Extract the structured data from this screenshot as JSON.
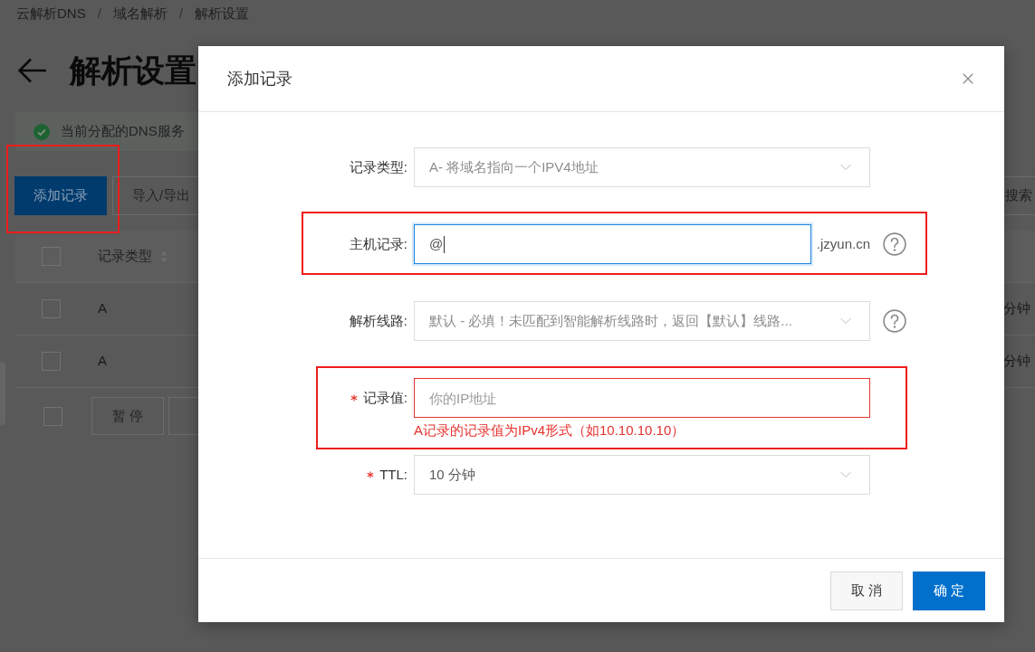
{
  "breadcrumb": {
    "items": [
      "云解析DNS",
      "域名解析",
      "解析设置"
    ],
    "separators": [
      "/",
      "/"
    ]
  },
  "page_title": "解析设置",
  "notice": {
    "text": "当前分配的DNS服务"
  },
  "toolbar": {
    "buttons": [
      {
        "label": "添加记录",
        "kind": "primary",
        "highlighted": true
      },
      {
        "label": "导入/导出",
        "kind": "default",
        "highlighted": false
      }
    ],
    "search_button": "搜索"
  },
  "table": {
    "header": {
      "checked": false,
      "columns": [
        "记录类型"
      ]
    },
    "rows": [
      {
        "checked": false,
        "record_type": "A",
        "column_3": "分钟"
      },
      {
        "checked": false,
        "record_type": "A",
        "column_3": "分钟"
      }
    ],
    "footer": {
      "checked": false,
      "buttons": [
        {
          "label": "暂 停",
          "disabled": true
        }
      ]
    }
  },
  "dialog": {
    "title": "添加记录",
    "fields": [
      {
        "kind": "select",
        "label": "记录类型:",
        "required": false,
        "value": "A- 将域名指向一个IPV4地址",
        "disabled": true,
        "help": false,
        "highlighted": false
      },
      {
        "kind": "input",
        "label": "主机记录:",
        "required": false,
        "value": "@",
        "focused": true,
        "suffix": ".jzyun.cn",
        "help": true,
        "highlighted": true
      },
      {
        "kind": "select",
        "label": "解析线路:",
        "required": false,
        "value": "默认 - 必填！未匹配到智能解析线路时，返回【默认】线路...",
        "disabled": true,
        "help": true,
        "highlighted": false
      },
      {
        "kind": "input",
        "label": "记录值:",
        "required": true,
        "placeholder": "你的IP地址",
        "focused": false,
        "error": "A记录的记录值为IPv4形式（如10.10.10.10）",
        "help": false,
        "highlighted": true
      },
      {
        "kind": "select",
        "label": "TTL:",
        "required": true,
        "value": "10 分钟",
        "disabled": false,
        "help": false,
        "highlighted": false
      }
    ],
    "buttons": [
      {
        "label": "取 消",
        "kind": "default"
      },
      {
        "label": "确 定",
        "kind": "primary"
      }
    ]
  }
}
